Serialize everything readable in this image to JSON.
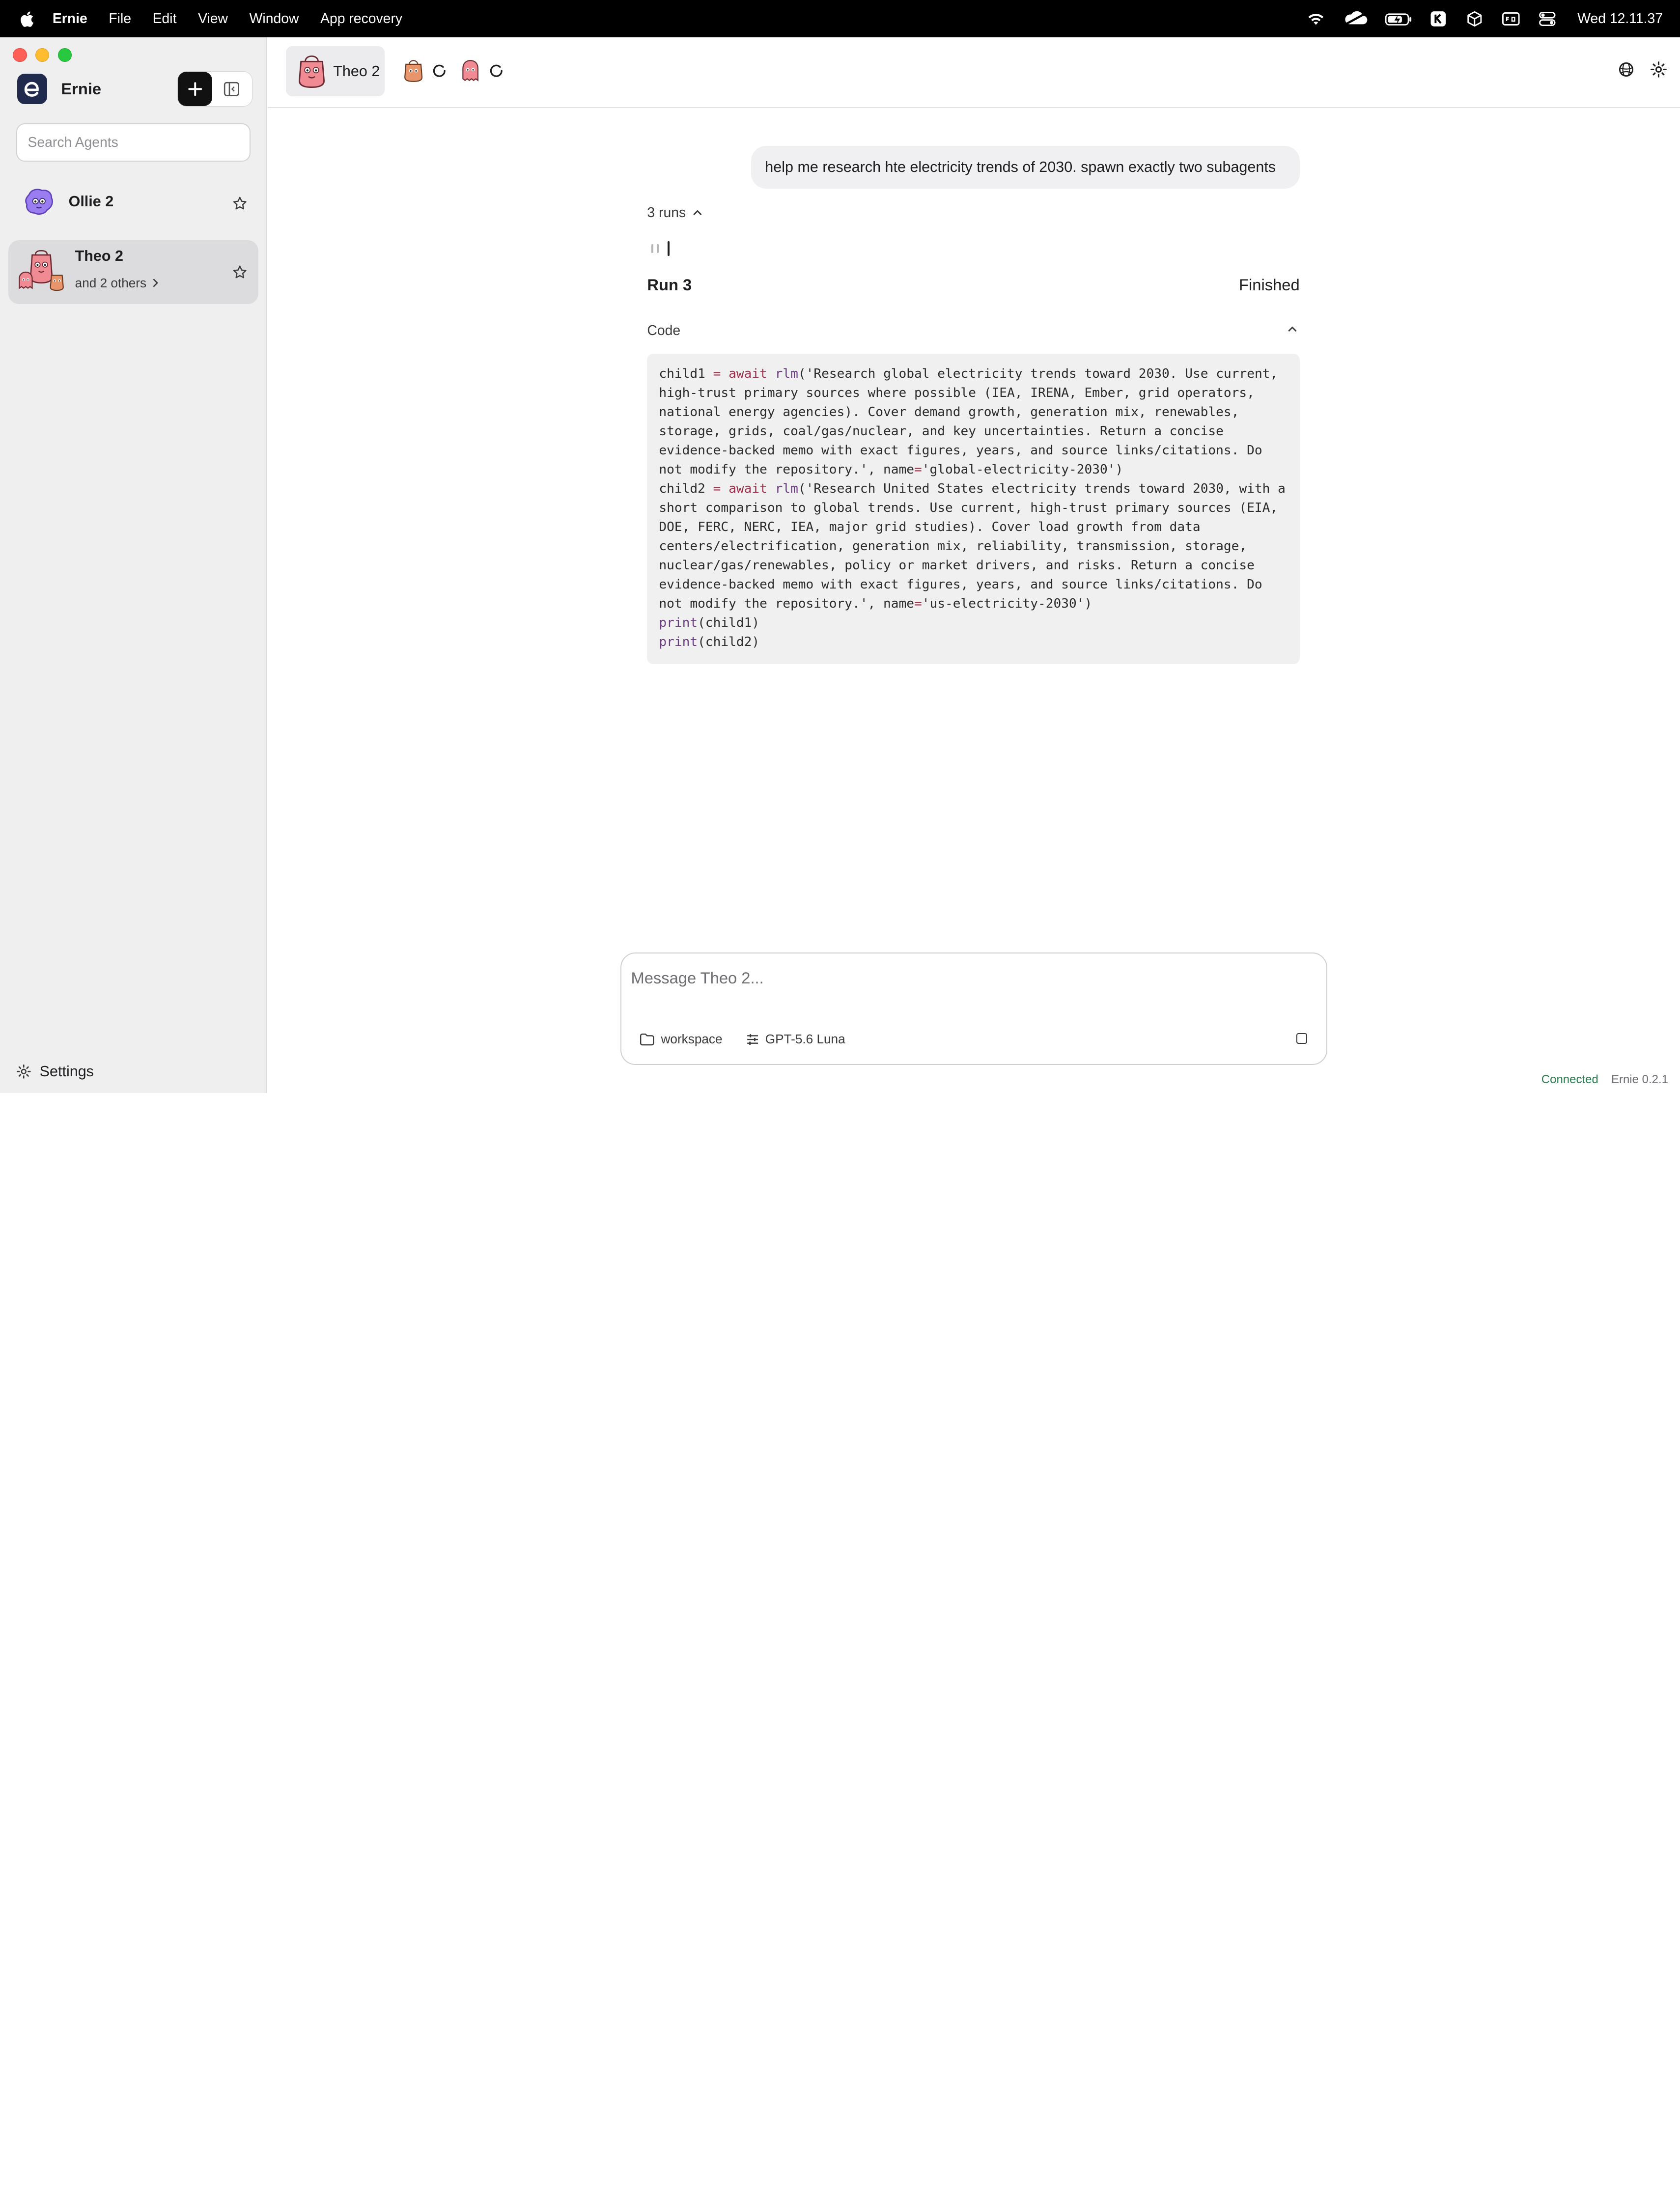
{
  "menubar": {
    "app_name": "Ernie",
    "items": [
      "File",
      "Edit",
      "View",
      "Window",
      "App recovery"
    ],
    "clock": "Wed 12.11.37",
    "status_icons": [
      "wifi-icon",
      "cloud-icon",
      "battery-icon",
      "k-app-icon",
      "cube-icon",
      "display-icon",
      "control-center-icon"
    ]
  },
  "sidebar": {
    "brand": "Ernie",
    "search_placeholder": "Search Agents",
    "agents": [
      {
        "name": "Ollie 2",
        "sub": ""
      },
      {
        "name": "Theo 2",
        "sub": "and 2 others"
      }
    ],
    "settings_label": "Settings"
  },
  "topbar": {
    "active_tab": "Theo 2",
    "right_icons": [
      "globe-icon",
      "gear-icon"
    ]
  },
  "chat": {
    "user_message": "help me research hte electricity trends of 2030. spawn exactly two subagents",
    "runs_label": "3 runs",
    "run_title": "Run 3",
    "run_status": "Finished",
    "code_label": "Code",
    "code_lines": [
      [
        [
          "child1 ",
          ""
        ],
        [
          "=",
          "kw-eq"
        ],
        [
          " ",
          ""
        ],
        [
          "await",
          "kw-await"
        ],
        [
          " ",
          ""
        ],
        [
          "rlm",
          "fn"
        ],
        [
          "('Research global electricity trends toward 2030. Use current,",
          ""
        ]
      ],
      [
        [
          "high-trust primary sources where possible (IEA, IRENA, Ember, grid operators,",
          ""
        ]
      ],
      [
        [
          "national energy agencies). Cover demand growth, generation mix, renewables,",
          ""
        ]
      ],
      [
        [
          "storage, grids, coal/gas/nuclear, and key uncertainties. Return a concise",
          ""
        ]
      ],
      [
        [
          "evidence-backed memo with exact figures, years, and source links/citations. Do",
          ""
        ]
      ],
      [
        [
          "not modify the repository.', name",
          ""
        ],
        [
          "=",
          "kw-eq"
        ],
        [
          "'global-electricity-2030')",
          ""
        ]
      ],
      [
        [
          "child2 ",
          ""
        ],
        [
          "=",
          "kw-eq"
        ],
        [
          " ",
          ""
        ],
        [
          "await",
          "kw-await"
        ],
        [
          " ",
          ""
        ],
        [
          "rlm",
          "fn"
        ],
        [
          "('Research United States electricity trends toward 2030, with a",
          ""
        ]
      ],
      [
        [
          "short comparison to global trends. Use current, high-trust primary sources (EIA,",
          ""
        ]
      ],
      [
        [
          "DOE, FERC, NERC, IEA, major grid studies). Cover load growth from data",
          ""
        ]
      ],
      [
        [
          "centers/electrification, generation mix, reliability, transmission, storage,",
          ""
        ]
      ],
      [
        [
          "nuclear/gas/renewables, policy or market drivers, and risks. Return a concise",
          ""
        ]
      ],
      [
        [
          "evidence-backed memo with exact figures, years, and source links/citations. Do",
          ""
        ]
      ],
      [
        [
          "not modify the repository.', name",
          ""
        ],
        [
          "=",
          "kw-eq"
        ],
        [
          "'us-electricity-2030')",
          ""
        ]
      ],
      [
        [
          "print",
          "fn"
        ],
        [
          "(child1)",
          ""
        ]
      ],
      [
        [
          "print",
          "fn"
        ],
        [
          "(child2)",
          ""
        ]
      ]
    ]
  },
  "composer": {
    "placeholder": "Message Theo 2...",
    "workspace_label": "workspace",
    "model_label": "GPT-5.6 Luna"
  },
  "status": {
    "connected": "Connected",
    "version": "Ernie 0.2.1"
  },
  "colors": {
    "accent_dark": "#111111",
    "sidebar_bg": "#efeff0",
    "connected_green": "#2a7d4f",
    "code_keyword": "#a0304a",
    "code_function": "#6a3d80"
  }
}
